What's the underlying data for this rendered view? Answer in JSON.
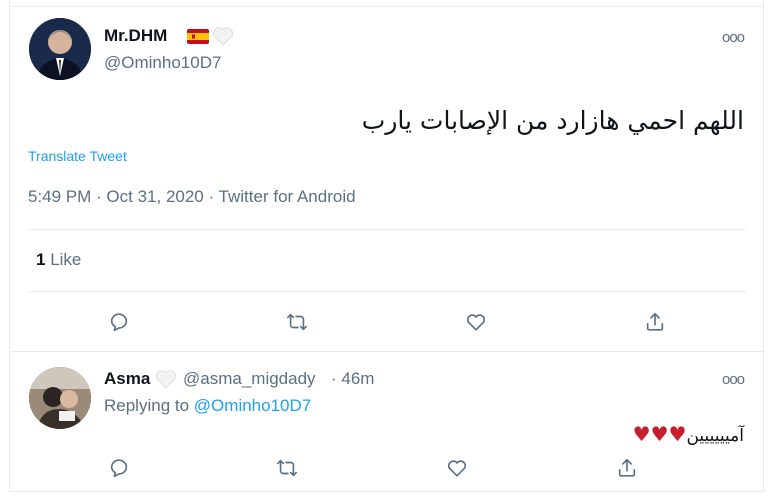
{
  "tweet": {
    "author_name": "Mr.DHM",
    "author_handle": "@Ominho10D7",
    "text": "اللهم احمي هازارد من الإصابات يارب",
    "translate_label": "Translate Tweet",
    "meta": "5:49 PM · Oct 31, 2020 · Twitter for Android",
    "like_count": "1",
    "like_label": "Like",
    "more_label": "ooo"
  },
  "reply": {
    "author_name": "Asma",
    "author_handle": "@asma_migdady",
    "time": "· 46m",
    "replying_prefix": "Replying to",
    "replying_handle": "@Ominho10D7",
    "text": "آميييييين",
    "hearts": "♥♥♥",
    "more_label": "ooo"
  },
  "colors": {
    "accent": "#1da1f2",
    "muted": "#5b7083",
    "heart": "#c81d2d"
  },
  "icons": {
    "reply": "comment-icon",
    "retweet": "retweet-icon",
    "like": "heart-icon",
    "share": "share-icon"
  }
}
